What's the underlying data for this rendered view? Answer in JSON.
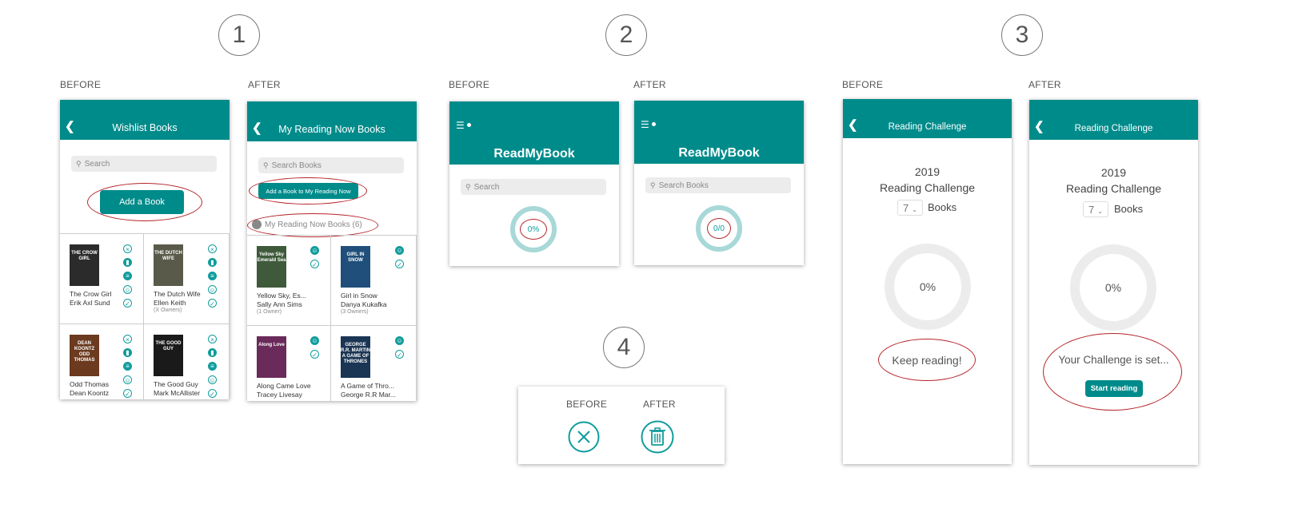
{
  "steps": [
    "1",
    "2",
    "3",
    "4"
  ],
  "labels": {
    "before": "BEFORE",
    "after": "AFTER"
  },
  "colors": {
    "brand": "#008b8b",
    "highlight_oval": "#b5252a",
    "ring_light": "#a8d8d8",
    "ring_grey": "#ececec"
  },
  "s1_before": {
    "title": "Wishlist Books",
    "search_placeholder": "Search",
    "add_button": "Add a Book",
    "books": [
      {
        "title": "The Crow Girl",
        "author": "Erik Axl Sund",
        "owners": "",
        "cover": "THE CROW GIRL",
        "cover_color": "#2b2b2b"
      },
      {
        "title": "The Dutch Wife",
        "author": "Ellen Keith",
        "owners": "(X Owners)",
        "cover": "THE DUTCH WIFE",
        "cover_color": "#5a5a4a"
      },
      {
        "title": "Odd Thomas",
        "author": "Dean Koontz",
        "owners": "",
        "cover": "DEAN KOONTZ ODD THOMAS",
        "cover_color": "#6b3a1f"
      },
      {
        "title": "The Good Guy",
        "author": "Mark McAllister",
        "owners": "",
        "cover": "THE GOOD GUY",
        "cover_color": "#1a1a1a"
      }
    ]
  },
  "s1_after": {
    "title": "My Reading Now Books",
    "search_placeholder": "Search Books",
    "add_button": "Add a Book to My Reading Now",
    "section_label": "My Reading Now Books (6)",
    "books": [
      {
        "title": "Yellow Sky, Es...",
        "author": "Sally Ann Sims",
        "owners": "(1 Owner)",
        "cover": "Yellow Sky Emerald Sea",
        "cover_color": "#3e5a3a"
      },
      {
        "title": "Girl in Snow",
        "author": "Danya Kukafka",
        "owners": "(3 Owners)",
        "cover": "GIRL IN SNOW",
        "cover_color": "#1f4f7a"
      },
      {
        "title": "Along Came Love",
        "author": "Tracey Livesay",
        "owners": "",
        "cover": "Along Love",
        "cover_color": "#6a2a5a"
      },
      {
        "title": "A Game of Thro...",
        "author": "George R.R Mar...",
        "owners": "",
        "cover": "GEORGE R.R. MARTIN A GAME OF THRONES",
        "cover_color": "#1b3554"
      }
    ]
  },
  "s2_before": {
    "app_title": "ReadMyBook",
    "search_placeholder": "Search",
    "progress": "0%"
  },
  "s2_after": {
    "app_title": "ReadMyBook",
    "search_placeholder": "Search Books",
    "progress": "0/0"
  },
  "s3_before": {
    "title": "Reading Challenge",
    "year": "2019",
    "heading": "Reading Challenge",
    "count": "7",
    "unit": "Books",
    "progress": "0%",
    "message": "Keep reading!"
  },
  "s3_after": {
    "title": "Reading Challenge",
    "year": "2019",
    "heading": "Reading Challenge",
    "count": "7",
    "unit": "Books",
    "progress": "0%",
    "message": "Your Challenge is set...",
    "button": "Start reading"
  },
  "s4": {
    "before_icon": "close-circle-icon",
    "after_icon": "trash-icon"
  }
}
